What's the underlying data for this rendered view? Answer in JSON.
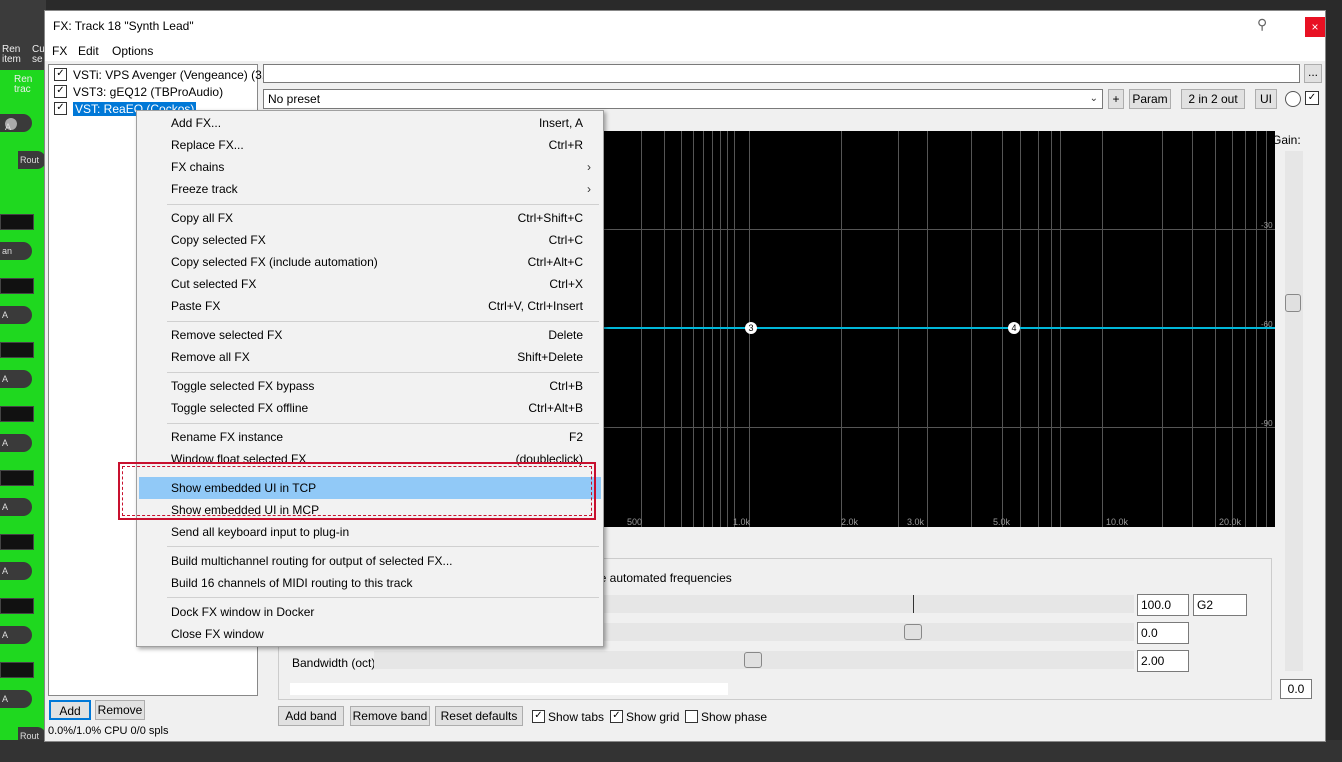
{
  "window": {
    "title": "FX: Track 18 \"Synth Lead\"",
    "close_glyph": "×",
    "pin_glyph": "⚲"
  },
  "menubar": {
    "fx": "FX",
    "edit": "Edit",
    "options": "Options"
  },
  "left_strip": {
    "top_labels": [
      "Ren",
      "item",
      "Cu",
      "se",
      "Ren",
      "trac"
    ],
    "knob_label": "A",
    "knob_label_pan": "an",
    "route_label": "Rout"
  },
  "fx_list": {
    "items": [
      {
        "label": "VSTi: VPS Avenger (Vengeance) (3...",
        "checked": true
      },
      {
        "label": "VST3: gEQ12 (TBProAudio)",
        "checked": true
      },
      {
        "label": "VST: ReaEQ (Cockos)",
        "checked": true,
        "selected": true
      }
    ],
    "check_glyph": "✓"
  },
  "buttons": {
    "add": "Add",
    "remove": "Remove",
    "more": "...",
    "plus": "+",
    "param": "Param",
    "io": "2 in 2 out",
    "ui": "UI",
    "add_band": "Add band",
    "remove_band": "Remove band",
    "reset_defaults": "Reset defaults"
  },
  "status": {
    "cpu": "0.0%/1.0% CPU 0/0 spls"
  },
  "preset": {
    "value": "No preset",
    "arrow": "⌄"
  },
  "eq": {
    "freq_ticks": [
      "500",
      "1.0k",
      "2.0k",
      "3.0k",
      "5.0k",
      "10.0k",
      "20.0k"
    ],
    "db_ticks": [
      "-30",
      "-60",
      "-90"
    ],
    "nodes": [
      "3",
      "4"
    ],
    "gain_label": "Gain:",
    "gain_value": "0.0",
    "automated_text": "le automated frequencies",
    "freq_value": "100.0",
    "note_value": "G2",
    "gain_field": "0.0",
    "bandwidth_label": "Bandwidth (oct):",
    "bandwidth_value": "2.00"
  },
  "checkboxes": {
    "show_tabs": {
      "label": "Show tabs",
      "checked": true
    },
    "show_grid": {
      "label": "Show grid",
      "checked": true
    },
    "show_phase": {
      "label": "Show phase",
      "checked": false
    }
  },
  "context_menu": {
    "submenu_arrow": "›",
    "items": [
      {
        "label": "Add FX...",
        "shortcut": "Insert, A"
      },
      {
        "label": "Replace FX...",
        "shortcut": "Ctrl+R"
      },
      {
        "label": "FX chains",
        "shortcut": "",
        "submenu": true
      },
      {
        "label": "Freeze track",
        "shortcut": "",
        "submenu": true
      },
      {
        "label": "Copy all FX",
        "shortcut": "Ctrl+Shift+C"
      },
      {
        "label": "Copy selected FX",
        "shortcut": "Ctrl+C"
      },
      {
        "label": "Copy selected FX (include automation)",
        "shortcut": "Ctrl+Alt+C"
      },
      {
        "label": "Cut selected FX",
        "shortcut": "Ctrl+X"
      },
      {
        "label": "Paste FX",
        "shortcut": "Ctrl+V, Ctrl+Insert"
      },
      {
        "label": "Remove selected FX",
        "shortcut": "Delete"
      },
      {
        "label": "Remove all FX",
        "shortcut": "Shift+Delete"
      },
      {
        "label": "Toggle selected FX bypass",
        "shortcut": "Ctrl+B"
      },
      {
        "label": "Toggle selected FX offline",
        "shortcut": "Ctrl+Alt+B"
      },
      {
        "label": "Rename FX instance",
        "shortcut": "F2"
      },
      {
        "label": "Window float selected FX",
        "shortcut": "(doubleclick)"
      },
      {
        "label": "Show embedded UI in TCP",
        "shortcut": "",
        "highlighted": true
      },
      {
        "label": "Show embedded UI in MCP",
        "shortcut": ""
      },
      {
        "label": "Send all keyboard input to plug-in",
        "shortcut": ""
      },
      {
        "label": "Build multichannel routing for output of selected FX...",
        "shortcut": ""
      },
      {
        "label": "Build 16 channels of MIDI routing to this track",
        "shortcut": ""
      },
      {
        "label": "Dock FX window in Docker",
        "shortcut": ""
      },
      {
        "label": "Close FX window",
        "shortcut": ""
      }
    ]
  },
  "colors": {
    "accent_selection": "#0078d7",
    "menu_highlight": "#91c9f7",
    "eq_line": "#00b7d9",
    "annotation_red": "#c8102e",
    "track_green": "#1fd81f"
  }
}
